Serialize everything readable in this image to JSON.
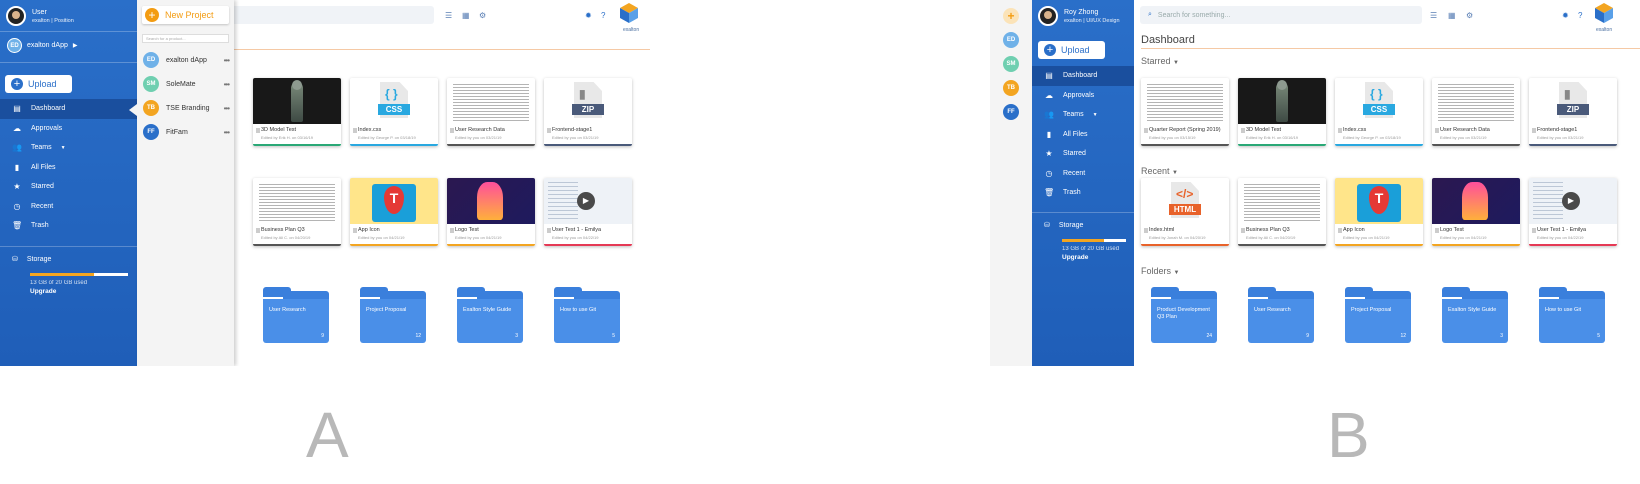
{
  "labels": {
    "a": "A",
    "b": "B"
  },
  "icons": [
    "shield-icon",
    "dashboard-icon",
    "cloud-icon",
    "users-icon",
    "file-icon",
    "star-icon",
    "clock-icon",
    "trash-icon",
    "storage-icon",
    "search-icon",
    "list-icon",
    "grid-icon",
    "filter-icon",
    "gear-icon",
    "help-icon",
    "logo-icon",
    "play-icon",
    "folder-icon"
  ],
  "colors": {
    "primary": "#2a6fc9",
    "accent": "#f39c12",
    "storage_fill": "#f3a521"
  },
  "a": {
    "user": {
      "name": "User",
      "role": "exalton | Position"
    },
    "current_project": {
      "initials": "ED",
      "name": "exalton dApp"
    },
    "upload_label": "Upload",
    "nav": [
      "Dashboard",
      "Approvals",
      "Teams",
      "All Files",
      "Starred",
      "Recent",
      "Trash"
    ],
    "storage": {
      "title": "Storage",
      "used": "13 GB of 20 GB used",
      "upgrade": "Upgrade",
      "fraction": 0.65
    },
    "logo_text": "exalton",
    "dropdown": {
      "new_project": "New Project",
      "search_placeholder": "Search for a product...",
      "projects": [
        {
          "initials": "ED",
          "name": "exalton dApp",
          "color": "#6fb1e8"
        },
        {
          "initials": "SM",
          "name": "SoleMate",
          "color": "#6fcfb0"
        },
        {
          "initials": "TB",
          "name": "TSE Branding",
          "color": "#f3a521"
        },
        {
          "initials": "FF",
          "name": "FitFam",
          "color": "#2a6fc9"
        }
      ]
    },
    "starred": [
      {
        "name": "3D Model Test",
        "sub": "Edited by Erik H. on 03/16/19",
        "bar": "#2aa876"
      },
      {
        "name": "Index.css",
        "sub": "Edited by George P. on 03/18/19",
        "bar": "#29a8e0"
      },
      {
        "name": "User Research Data",
        "sub": "Edited by you on 03/21/19",
        "bar": "#555555"
      },
      {
        "name": "Frontend-stage1",
        "sub": "Edited by you on 03/21/19",
        "bar": "#4a5a7a"
      }
    ],
    "recent": [
      {
        "name": "Business Plan Q3",
        "sub": "Edited by Ali C. on 04/20/19",
        "bar": "#555555"
      },
      {
        "name": "App Icon",
        "sub": "Edited by you on 04/21/19",
        "bar": "#f3a521"
      },
      {
        "name": "Logo Test",
        "sub": "Edited by you on 04/21/19",
        "bar": "#f3a521"
      },
      {
        "name": "User Test 1 - Emilya",
        "sub": "Edited by you on 04/22/19",
        "bar": "#e53955"
      }
    ],
    "folders": [
      {
        "name": "User Research",
        "count": "9"
      },
      {
        "name": "Project Proposal",
        "count": "12"
      },
      {
        "name": "Exalton Style Guide",
        "count": "3"
      },
      {
        "name": "How to use Git",
        "count": "5"
      }
    ]
  },
  "b": {
    "user": {
      "name": "Roy Zhong",
      "role": "exalton | UI/UX Design"
    },
    "rail": [
      "ED",
      "SM",
      "TB",
      "FF"
    ],
    "upload_label": "Upload",
    "nav": [
      "Dashboard",
      "Approvals",
      "Teams",
      "All Files",
      "Starred",
      "Recent",
      "Trash"
    ],
    "storage": {
      "title": "Storage",
      "used": "13 GB of 20 GB used",
      "upgrade": "Upgrade",
      "fraction": 0.65
    },
    "search_placeholder": "Search for something...",
    "page_title": "Dashboard",
    "sections": {
      "starred": "Starred",
      "recent": "Recent",
      "folders": "Folders"
    },
    "logo_text": "exalton",
    "starred": [
      {
        "name": "Quarter Report (Spring 2019)",
        "sub": "Edited by you on 03/15/19",
        "bar": "#555555"
      },
      {
        "name": "3D Model Test",
        "sub": "Edited by Erik H. on 03/16/19",
        "bar": "#2aa876"
      },
      {
        "name": "Index.css",
        "sub": "Edited by George P. on 03/18/19",
        "bar": "#29a8e0"
      },
      {
        "name": "User Research Data",
        "sub": "Edited by you on 03/21/19",
        "bar": "#555555"
      },
      {
        "name": "Frontend-stage1",
        "sub": "Edited by you on 03/21/19",
        "bar": "#4a5a7a"
      }
    ],
    "recent": [
      {
        "name": "Index.html",
        "sub": "Edited by Jonah M. on 04/20/19",
        "bar": "#e8622a"
      },
      {
        "name": "Business Plan Q3",
        "sub": "Edited by Ali C. on 04/20/19",
        "bar": "#555555"
      },
      {
        "name": "App Icon",
        "sub": "Edited by you on 04/21/19",
        "bar": "#f3a521"
      },
      {
        "name": "Logo Test",
        "sub": "Edited by you on 04/21/19",
        "bar": "#f3a521"
      },
      {
        "name": "User Test 1 - Emilya",
        "sub": "Edited by you on 04/22/19",
        "bar": "#e53955"
      }
    ],
    "folders": [
      {
        "name": "Product Development Q3 Plan",
        "count": "24"
      },
      {
        "name": "User Research",
        "count": "9"
      },
      {
        "name": "Project Proposal",
        "count": "12"
      },
      {
        "name": "Exalton Style Guide",
        "count": "3"
      },
      {
        "name": "How to use Git",
        "count": "5"
      }
    ]
  }
}
